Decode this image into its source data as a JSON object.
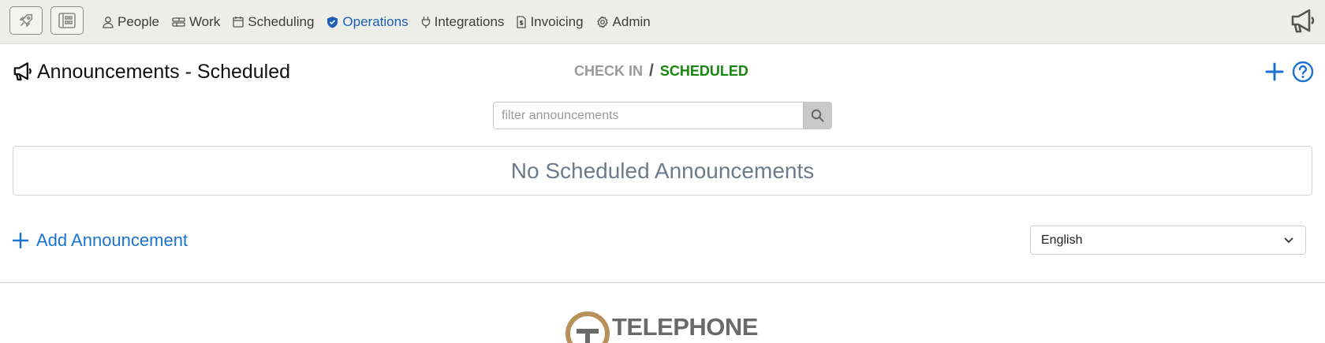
{
  "nav": {
    "rocket_button_icon": "rocket-icon",
    "dashboard_button_icon": "dashboard-icon",
    "items": [
      {
        "label": "People",
        "icon": "person-icon",
        "active": false
      },
      {
        "label": "Work",
        "icon": "work-icon",
        "active": false
      },
      {
        "label": "Scheduling",
        "icon": "calendar-icon",
        "active": false
      },
      {
        "label": "Operations",
        "icon": "shield-check-icon",
        "active": true
      },
      {
        "label": "Integrations",
        "icon": "plug-icon",
        "active": false
      },
      {
        "label": "Invoicing",
        "icon": "invoice-icon",
        "active": false
      },
      {
        "label": "Admin",
        "icon": "gear-icon",
        "active": false
      }
    ]
  },
  "header": {
    "title": "Announcements - Scheduled",
    "views": {
      "check_in": "CHECK IN",
      "separator": "/",
      "scheduled": "SCHEDULED"
    }
  },
  "filter": {
    "placeholder": "filter announcements",
    "value": ""
  },
  "empty_message": "No Scheduled Announcements",
  "add_label": "Add Announcement",
  "language": {
    "selected": "English"
  },
  "footer": {
    "logo_text": "TELEPHONE"
  },
  "colors": {
    "accent": "#1a73d1",
    "active_nav": "#1c5eb6",
    "scheduled_green": "#18870f",
    "muted": "#9a9a9a",
    "topnav_bg": "#eeeee8",
    "logo_gold": "#b8915a"
  }
}
